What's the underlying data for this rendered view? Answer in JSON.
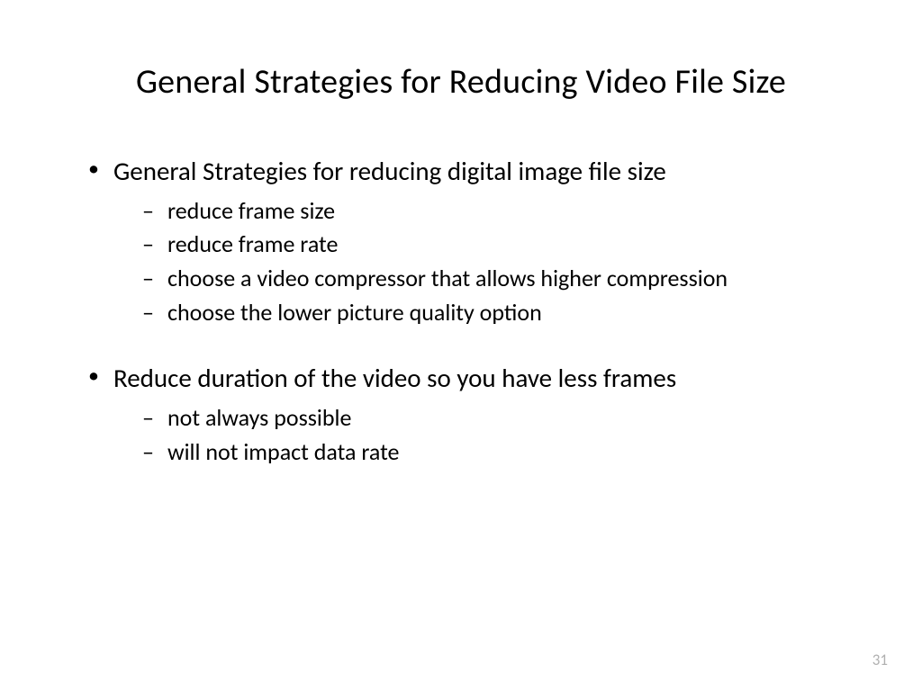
{
  "slide": {
    "title": "General Strategies for Reducing Video File Size",
    "bullets": [
      {
        "text": "General Strategies for reducing digital image file size",
        "sub": [
          "reduce frame size",
          "reduce frame rate",
          "choose a video compressor that allows higher compression",
          "choose the lower picture quality option"
        ]
      },
      {
        "text": "Reduce duration of the video so you have less frames",
        "sub": [
          "not always possible",
          "will not impact data rate"
        ]
      }
    ],
    "page_number": "31"
  }
}
